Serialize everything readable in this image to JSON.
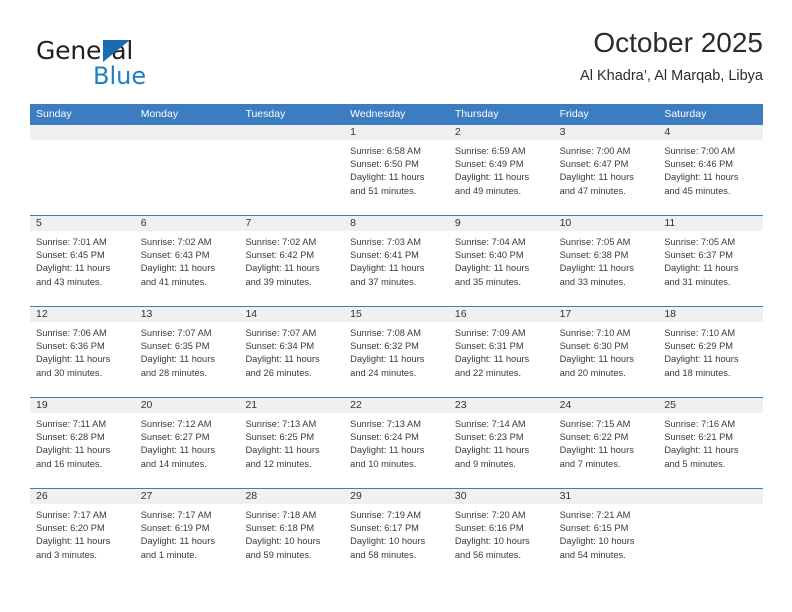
{
  "brand": {
    "name_part1": "General",
    "name_part2": "Blue",
    "triangle_color": "#1b6bb0",
    "blue_color": "#1f7fc4"
  },
  "header": {
    "title": "October 2025",
    "subtitle": "Al Khadra’, Al Marqab, Libya"
  },
  "theme": {
    "header_row_bg": "#3b7dc0",
    "week_strip_bg": "#f0f0f0",
    "row_divider": "#3b7dc0",
    "text": "#333333"
  },
  "weekdays": [
    "Sunday",
    "Monday",
    "Tuesday",
    "Wednesday",
    "Thursday",
    "Friday",
    "Saturday"
  ],
  "weeks": [
    [
      {
        "day": "",
        "sunrise": "",
        "sunset": "",
        "daylight1": "",
        "daylight2": ""
      },
      {
        "day": "",
        "sunrise": "",
        "sunset": "",
        "daylight1": "",
        "daylight2": ""
      },
      {
        "day": "",
        "sunrise": "",
        "sunset": "",
        "daylight1": "",
        "daylight2": ""
      },
      {
        "day": "1",
        "sunrise": "Sunrise: 6:58 AM",
        "sunset": "Sunset: 6:50 PM",
        "daylight1": "Daylight: 11 hours",
        "daylight2": "and 51 minutes."
      },
      {
        "day": "2",
        "sunrise": "Sunrise: 6:59 AM",
        "sunset": "Sunset: 6:49 PM",
        "daylight1": "Daylight: 11 hours",
        "daylight2": "and 49 minutes."
      },
      {
        "day": "3",
        "sunrise": "Sunrise: 7:00 AM",
        "sunset": "Sunset: 6:47 PM",
        "daylight1": "Daylight: 11 hours",
        "daylight2": "and 47 minutes."
      },
      {
        "day": "4",
        "sunrise": "Sunrise: 7:00 AM",
        "sunset": "Sunset: 6:46 PM",
        "daylight1": "Daylight: 11 hours",
        "daylight2": "and 45 minutes."
      }
    ],
    [
      {
        "day": "5",
        "sunrise": "Sunrise: 7:01 AM",
        "sunset": "Sunset: 6:45 PM",
        "daylight1": "Daylight: 11 hours",
        "daylight2": "and 43 minutes."
      },
      {
        "day": "6",
        "sunrise": "Sunrise: 7:02 AM",
        "sunset": "Sunset: 6:43 PM",
        "daylight1": "Daylight: 11 hours",
        "daylight2": "and 41 minutes."
      },
      {
        "day": "7",
        "sunrise": "Sunrise: 7:02 AM",
        "sunset": "Sunset: 6:42 PM",
        "daylight1": "Daylight: 11 hours",
        "daylight2": "and 39 minutes."
      },
      {
        "day": "8",
        "sunrise": "Sunrise: 7:03 AM",
        "sunset": "Sunset: 6:41 PM",
        "daylight1": "Daylight: 11 hours",
        "daylight2": "and 37 minutes."
      },
      {
        "day": "9",
        "sunrise": "Sunrise: 7:04 AM",
        "sunset": "Sunset: 6:40 PM",
        "daylight1": "Daylight: 11 hours",
        "daylight2": "and 35 minutes."
      },
      {
        "day": "10",
        "sunrise": "Sunrise: 7:05 AM",
        "sunset": "Sunset: 6:38 PM",
        "daylight1": "Daylight: 11 hours",
        "daylight2": "and 33 minutes."
      },
      {
        "day": "11",
        "sunrise": "Sunrise: 7:05 AM",
        "sunset": "Sunset: 6:37 PM",
        "daylight1": "Daylight: 11 hours",
        "daylight2": "and 31 minutes."
      }
    ],
    [
      {
        "day": "12",
        "sunrise": "Sunrise: 7:06 AM",
        "sunset": "Sunset: 6:36 PM",
        "daylight1": "Daylight: 11 hours",
        "daylight2": "and 30 minutes."
      },
      {
        "day": "13",
        "sunrise": "Sunrise: 7:07 AM",
        "sunset": "Sunset: 6:35 PM",
        "daylight1": "Daylight: 11 hours",
        "daylight2": "and 28 minutes."
      },
      {
        "day": "14",
        "sunrise": "Sunrise: 7:07 AM",
        "sunset": "Sunset: 6:34 PM",
        "daylight1": "Daylight: 11 hours",
        "daylight2": "and 26 minutes."
      },
      {
        "day": "15",
        "sunrise": "Sunrise: 7:08 AM",
        "sunset": "Sunset: 6:32 PM",
        "daylight1": "Daylight: 11 hours",
        "daylight2": "and 24 minutes."
      },
      {
        "day": "16",
        "sunrise": "Sunrise: 7:09 AM",
        "sunset": "Sunset: 6:31 PM",
        "daylight1": "Daylight: 11 hours",
        "daylight2": "and 22 minutes."
      },
      {
        "day": "17",
        "sunrise": "Sunrise: 7:10 AM",
        "sunset": "Sunset: 6:30 PM",
        "daylight1": "Daylight: 11 hours",
        "daylight2": "and 20 minutes."
      },
      {
        "day": "18",
        "sunrise": "Sunrise: 7:10 AM",
        "sunset": "Sunset: 6:29 PM",
        "daylight1": "Daylight: 11 hours",
        "daylight2": "and 18 minutes."
      }
    ],
    [
      {
        "day": "19",
        "sunrise": "Sunrise: 7:11 AM",
        "sunset": "Sunset: 6:28 PM",
        "daylight1": "Daylight: 11 hours",
        "daylight2": "and 16 minutes."
      },
      {
        "day": "20",
        "sunrise": "Sunrise: 7:12 AM",
        "sunset": "Sunset: 6:27 PM",
        "daylight1": "Daylight: 11 hours",
        "daylight2": "and 14 minutes."
      },
      {
        "day": "21",
        "sunrise": "Sunrise: 7:13 AM",
        "sunset": "Sunset: 6:25 PM",
        "daylight1": "Daylight: 11 hours",
        "daylight2": "and 12 minutes."
      },
      {
        "day": "22",
        "sunrise": "Sunrise: 7:13 AM",
        "sunset": "Sunset: 6:24 PM",
        "daylight1": "Daylight: 11 hours",
        "daylight2": "and 10 minutes."
      },
      {
        "day": "23",
        "sunrise": "Sunrise: 7:14 AM",
        "sunset": "Sunset: 6:23 PM",
        "daylight1": "Daylight: 11 hours",
        "daylight2": "and 9 minutes."
      },
      {
        "day": "24",
        "sunrise": "Sunrise: 7:15 AM",
        "sunset": "Sunset: 6:22 PM",
        "daylight1": "Daylight: 11 hours",
        "daylight2": "and 7 minutes."
      },
      {
        "day": "25",
        "sunrise": "Sunrise: 7:16 AM",
        "sunset": "Sunset: 6:21 PM",
        "daylight1": "Daylight: 11 hours",
        "daylight2": "and 5 minutes."
      }
    ],
    [
      {
        "day": "26",
        "sunrise": "Sunrise: 7:17 AM",
        "sunset": "Sunset: 6:20 PM",
        "daylight1": "Daylight: 11 hours",
        "daylight2": "and 3 minutes."
      },
      {
        "day": "27",
        "sunrise": "Sunrise: 7:17 AM",
        "sunset": "Sunset: 6:19 PM",
        "daylight1": "Daylight: 11 hours",
        "daylight2": "and 1 minute."
      },
      {
        "day": "28",
        "sunrise": "Sunrise: 7:18 AM",
        "sunset": "Sunset: 6:18 PM",
        "daylight1": "Daylight: 10 hours",
        "daylight2": "and 59 minutes."
      },
      {
        "day": "29",
        "sunrise": "Sunrise: 7:19 AM",
        "sunset": "Sunset: 6:17 PM",
        "daylight1": "Daylight: 10 hours",
        "daylight2": "and 58 minutes."
      },
      {
        "day": "30",
        "sunrise": "Sunrise: 7:20 AM",
        "sunset": "Sunset: 6:16 PM",
        "daylight1": "Daylight: 10 hours",
        "daylight2": "and 56 minutes."
      },
      {
        "day": "31",
        "sunrise": "Sunrise: 7:21 AM",
        "sunset": "Sunset: 6:15 PM",
        "daylight1": "Daylight: 10 hours",
        "daylight2": "and 54 minutes."
      },
      {
        "day": "",
        "sunrise": "",
        "sunset": "",
        "daylight1": "",
        "daylight2": ""
      }
    ]
  ]
}
